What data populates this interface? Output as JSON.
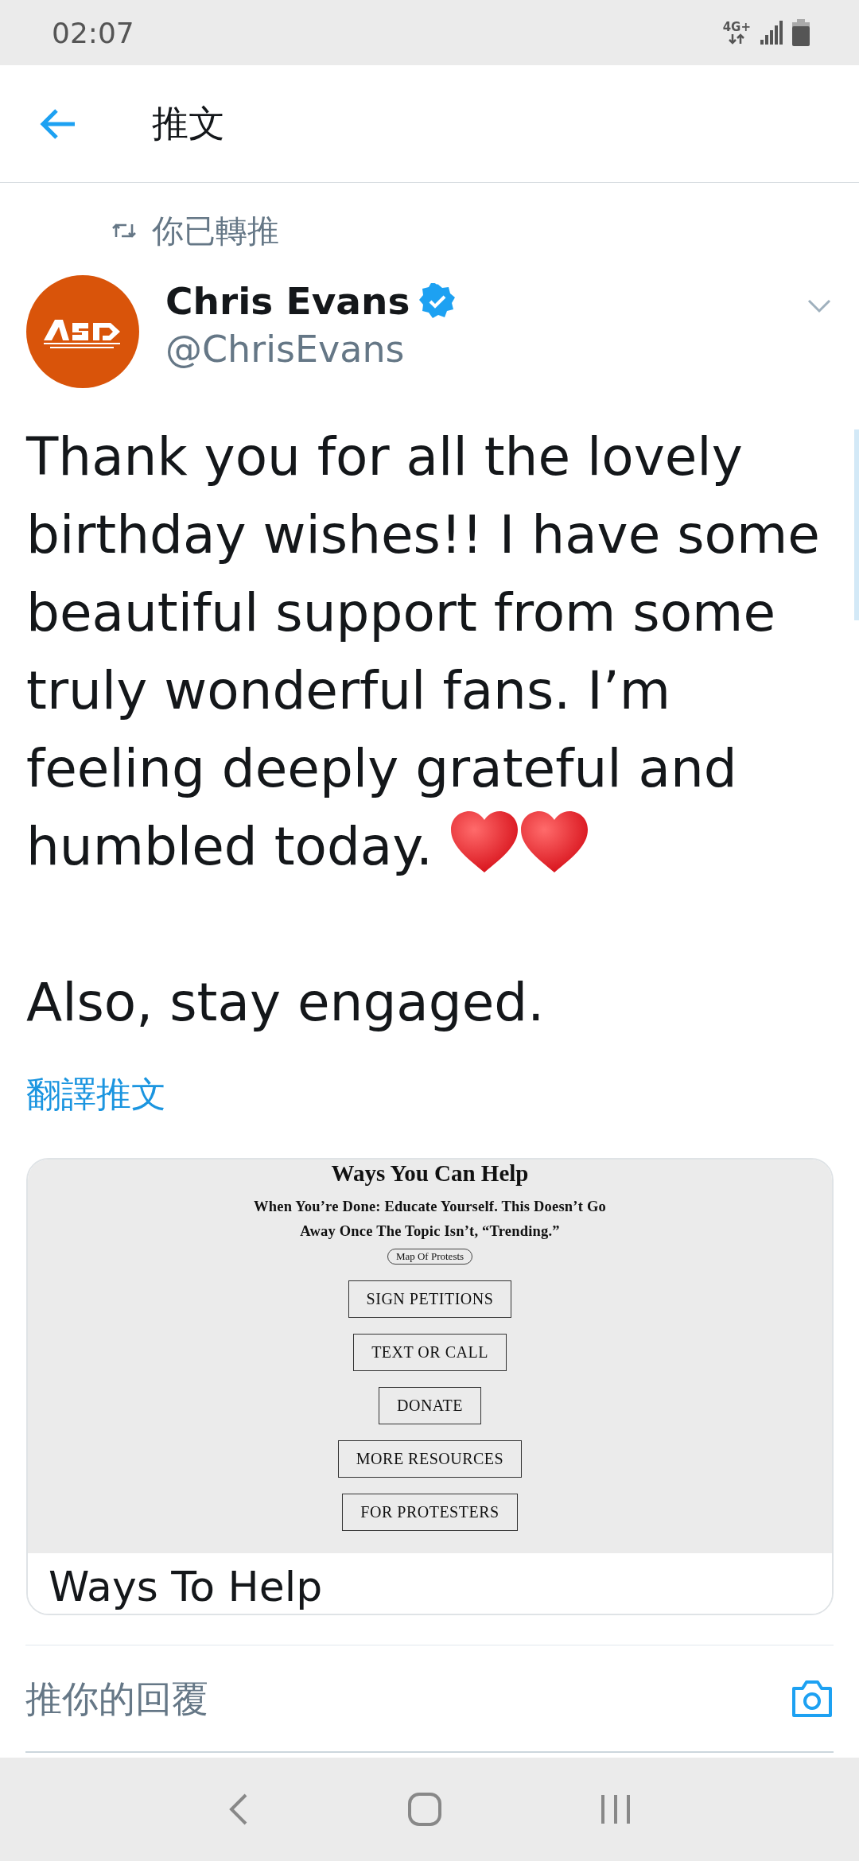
{
  "status_bar": {
    "time": "02:07",
    "network": "4G+"
  },
  "header": {
    "title": "推文"
  },
  "tweet": {
    "retweet_label": "你已轉推",
    "author": {
      "name": "Chris Evans",
      "verified": true,
      "handle": "@ChrisEvans"
    },
    "paragraphs": [
      {
        "text": "Thank you for all the lovely birthday wishes!! I have some beautiful support from some truly wonderful fans. I’m feeling deeply grateful and humbled today.",
        "hearts": true
      },
      {
        "text": "Also, stay engaged.",
        "hearts": false
      }
    ],
    "translate_link": "翻譯推文",
    "card": {
      "preview": {
        "heading": "Ways You Can Help",
        "subtitle": "When You’re Done: Educate Yourself. This Doesn’t Go Away Once The Topic Isn’t, “Trending.”",
        "pill": "Map Of Protests",
        "buttons": [
          "SIGN PETITIONS",
          "TEXT OR CALL",
          "DONATE",
          "MORE RESOURCES",
          "FOR PROTESTERS"
        ]
      },
      "title": "Ways To Help"
    }
  },
  "reply": {
    "placeholder": "推你的回覆"
  }
}
